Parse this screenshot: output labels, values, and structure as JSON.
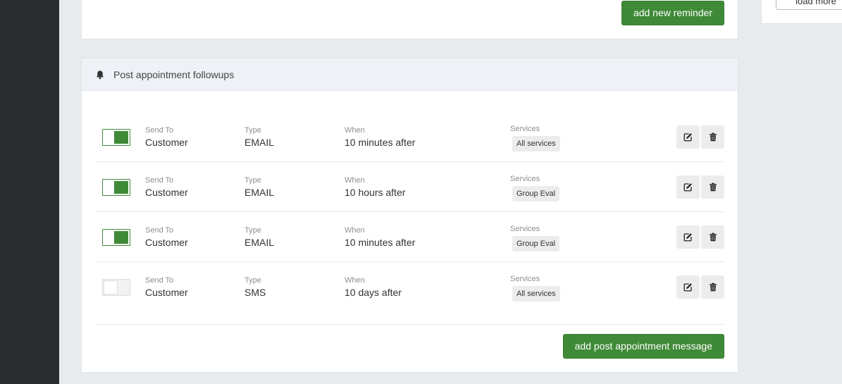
{
  "top_card": {
    "add_reminder_label": "add new reminder"
  },
  "right_panel": {
    "load_more_label": "load more"
  },
  "followups": {
    "title": "Post appointment followups",
    "labels": {
      "send_to": "Send To",
      "type": "Type",
      "when": "When",
      "services": "Services"
    },
    "rows": [
      {
        "enabled": true,
        "send_to": "Customer",
        "type": "EMAIL",
        "when": "10 minutes after",
        "service": "All services"
      },
      {
        "enabled": true,
        "send_to": "Customer",
        "type": "EMAIL",
        "when": "10 hours after",
        "service": "Group Eval"
      },
      {
        "enabled": true,
        "send_to": "Customer",
        "type": "EMAIL",
        "when": "10 minutes after",
        "service": "Group Eval"
      },
      {
        "enabled": false,
        "send_to": "Customer",
        "type": "SMS",
        "when": "10 days after",
        "service": "All services"
      }
    ],
    "add_post_label": "add post appointment message"
  },
  "icons": {
    "header": "bell-icon",
    "edit": "edit-icon",
    "delete": "trash-icon"
  },
  "colors": {
    "accent": "#3f8a37",
    "sidebar": "#2a2c2f",
    "background": "#e8ebed"
  }
}
